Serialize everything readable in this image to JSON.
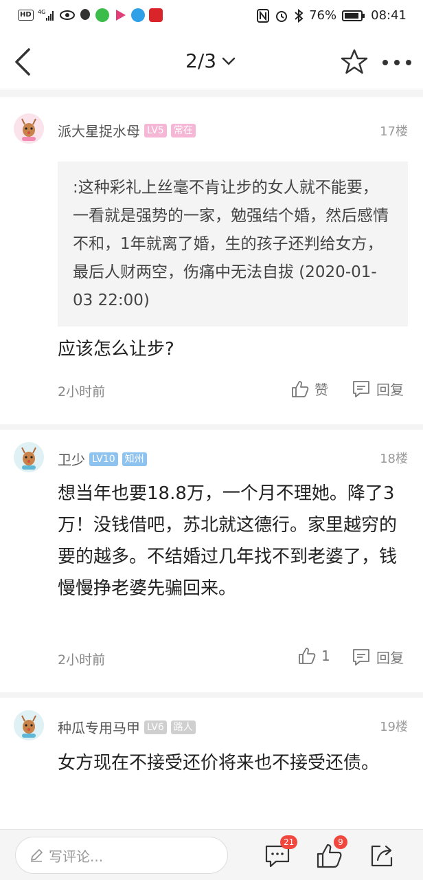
{
  "status_bar": {
    "battery": "76%",
    "time": "08:41",
    "icons": [
      "hd-icon",
      "signal-icon",
      "eye-icon",
      "qq-icon",
      "app-icon",
      "video-icon",
      "browser-icon",
      "news-app-icon",
      "nfc-icon",
      "alarm-icon",
      "bluetooth-icon",
      "battery-icon"
    ]
  },
  "header": {
    "page_indicator": "2/3",
    "back_icon": "chevron-left-icon",
    "dropdown_icon": "chevron-down-icon",
    "star_icon": "star-icon",
    "more_icon": "more-dots-icon"
  },
  "comments": [
    {
      "username": "派大星捉水母",
      "level": "LV5",
      "tag": "常在",
      "floor": "17楼",
      "quote": ":这种彩礼上丝毫不肯让步的女人就不能要，一看就是强势的一家，勉强结个婚，然后感情不和，1年就离了婚，生的孩子还判给女方，最后人财两空，伤痛中无法自拔 (2020-01-03 22:00)",
      "text": "应该怎么让步?",
      "time": "2小时前",
      "like_label": "赞",
      "reply_label": "回复",
      "colors": {
        "level_bg": "#f6b7d6",
        "tag_bg": "#f6b7d6"
      }
    },
    {
      "username": "卫少",
      "level": "LV10",
      "tag": "知州",
      "floor": "18楼",
      "text": "想当年也要18.8万，一个月不理她。降了3万！没钱借吧，苏北就这德行。家里越穷的要的越多。不结婚过几年找不到老婆了，钱慢慢挣老婆先骗回来。",
      "time": "2小时前",
      "like_label": "1",
      "reply_label": "回复",
      "colors": {
        "level_bg": "#8fc3ef",
        "tag_bg": "#8fc3ef"
      }
    },
    {
      "username": "种瓜专用马甲",
      "level": "LV6",
      "tag": "路人",
      "floor": "19楼",
      "text": "女方现在不接受还价将来也不接受还债。",
      "colors": {
        "level_bg": "#cfcfcf",
        "tag_bg": "#cfcfcf"
      }
    }
  ],
  "bottom_bar": {
    "comment_placeholder": "写评论...",
    "comment_count": "21",
    "like_count": "9"
  },
  "colors": {
    "badge_red": "#f0483e",
    "separator": "#f4f4f4"
  }
}
